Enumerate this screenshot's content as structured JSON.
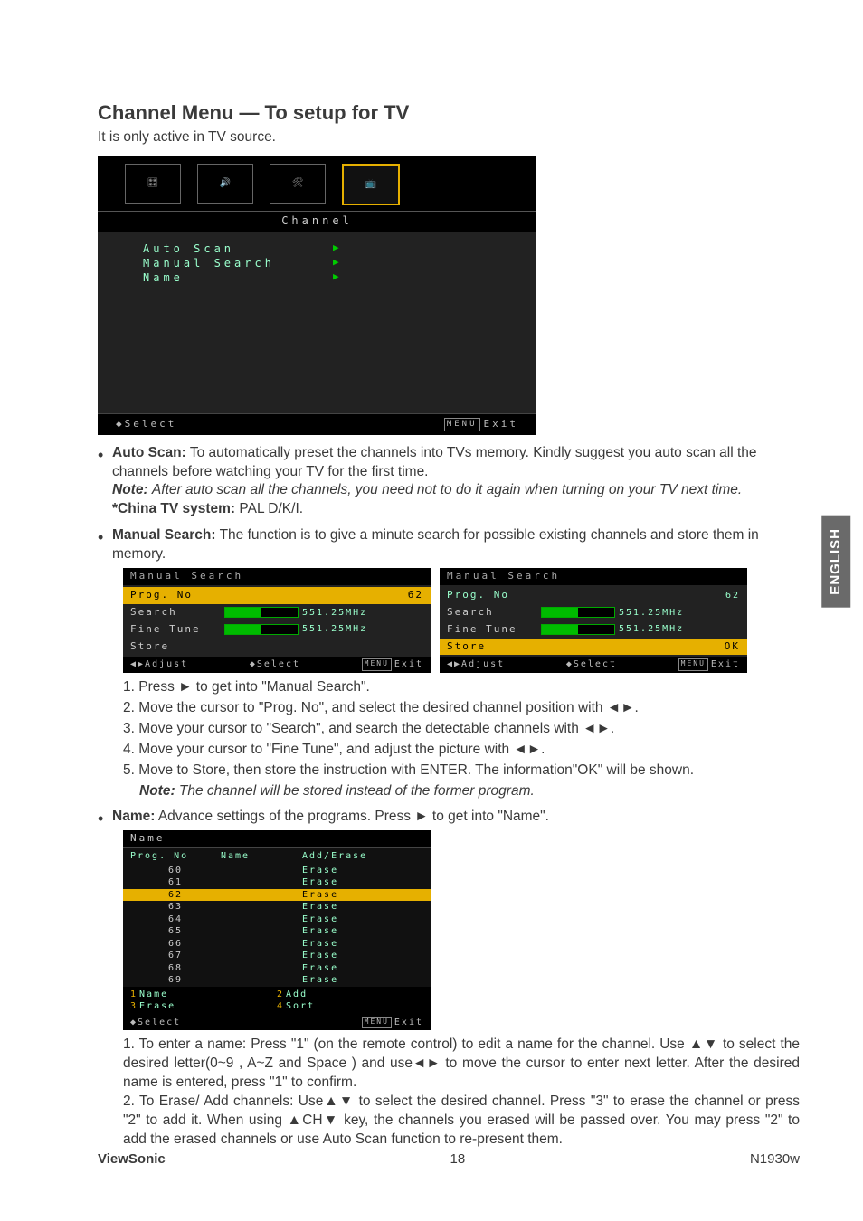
{
  "title": "Channel Menu — To setup for TV",
  "subhead": "It is only active in TV source.",
  "side_tab": "ENGLISH",
  "channel_osd": {
    "title": "Channel",
    "items": [
      "Auto Scan",
      "Manual Search",
      "Name"
    ],
    "footer_left_glyph": "◆",
    "footer_left": "Select",
    "footer_right_tag": "MENU",
    "footer_right": "Exit"
  },
  "auto_scan": {
    "label": "Auto Scan:",
    "text": "To automatically preset the channels into TVs memory. Kindly suggest you auto scan all the channels before watching your TV for the first time.",
    "note_label": "Note:",
    "note": "After auto scan all the channels, you need not to do it again when turning on your TV next time.",
    "china_label": "*China TV system:",
    "china_val": "PAL D/K/I."
  },
  "manual_search": {
    "label": "Manual Search:",
    "intro": "The function is to give a minute search for possible existing channels and store them in memory.",
    "osd_title": "Manual Search",
    "rows": {
      "prog_label": "Prog. No",
      "prog_val": "62",
      "search_label": "Search",
      "search_val": "551.25MHz",
      "fine_label": "Fine Tune",
      "fine_val": "551.25MHz",
      "store_label": "Store",
      "store_ok": "OK"
    },
    "footer": {
      "adjust_glyph": "◀▶",
      "adjust": "Adjust",
      "select_glyph": "◆",
      "select": "Select",
      "exit_tag": "MENU",
      "exit": "Exit"
    },
    "steps": [
      "1. Press ► to get into \"Manual Search\".",
      "2. Move the cursor to \"Prog. No\", and select the desired channel position with ◄►.",
      "3. Move your cursor to \"Search\", and search the detectable channels with ◄►.",
      "4. Move your cursor to \"Fine Tune\", and adjust the picture with ◄►.",
      "5. Move to Store, then store the instruction with ENTER. The information\"OK\" will be shown."
    ],
    "step_note_label": "Note:",
    "step_note": "The channel will be stored instead of the former program."
  },
  "name": {
    "label": "Name:",
    "intro": "Advance settings of the programs. Press ► to get into \"Name\".",
    "osd_title": "Name",
    "col1": "Prog. No",
    "col2": "Name",
    "col3": "Add/Erase",
    "rows": [
      {
        "no": "60",
        "act": "Erase"
      },
      {
        "no": "61",
        "act": "Erase"
      },
      {
        "no": "62",
        "act": "Erase",
        "sel": true
      },
      {
        "no": "63",
        "act": "Erase"
      },
      {
        "no": "64",
        "act": "Erase"
      },
      {
        "no": "65",
        "act": "Erase"
      },
      {
        "no": "66",
        "act": "Erase"
      },
      {
        "no": "67",
        "act": "Erase"
      },
      {
        "no": "68",
        "act": "Erase"
      },
      {
        "no": "69",
        "act": "Erase"
      }
    ],
    "cmds": [
      {
        "n": "1",
        "t": "Name"
      },
      {
        "n": "2",
        "t": "Add"
      },
      {
        "n": "3",
        "t": "Erase"
      },
      {
        "n": "4",
        "t": "Sort"
      }
    ],
    "footer": {
      "select_glyph": "◆",
      "select": "Select",
      "exit_tag": "MENU",
      "exit": "Exit"
    },
    "instr1_a": "1. To enter a name: Press \"1\" (on the remote control) to edit a name for the channel. Use ▲▼ to select the desired letter(0~9 , A~Z and Space ) and use◄► to move the cursor to enter next letter. After the desired name is entered, press \"1\"  to confirm.",
    "instr2_a": "2.  To Erase/ Add channels: Use▲▼ to select the desired channel. Press \"3\" to erase the channel or press \"2\" to add it. When using ▲CH▼ key, the channels you erased will be passed over. You may press \"2\"  to add the erased channels or use Auto Scan function to re-present them."
  },
  "footer": {
    "left": "ViewSonic",
    "center": "18",
    "right": "N1930w"
  }
}
